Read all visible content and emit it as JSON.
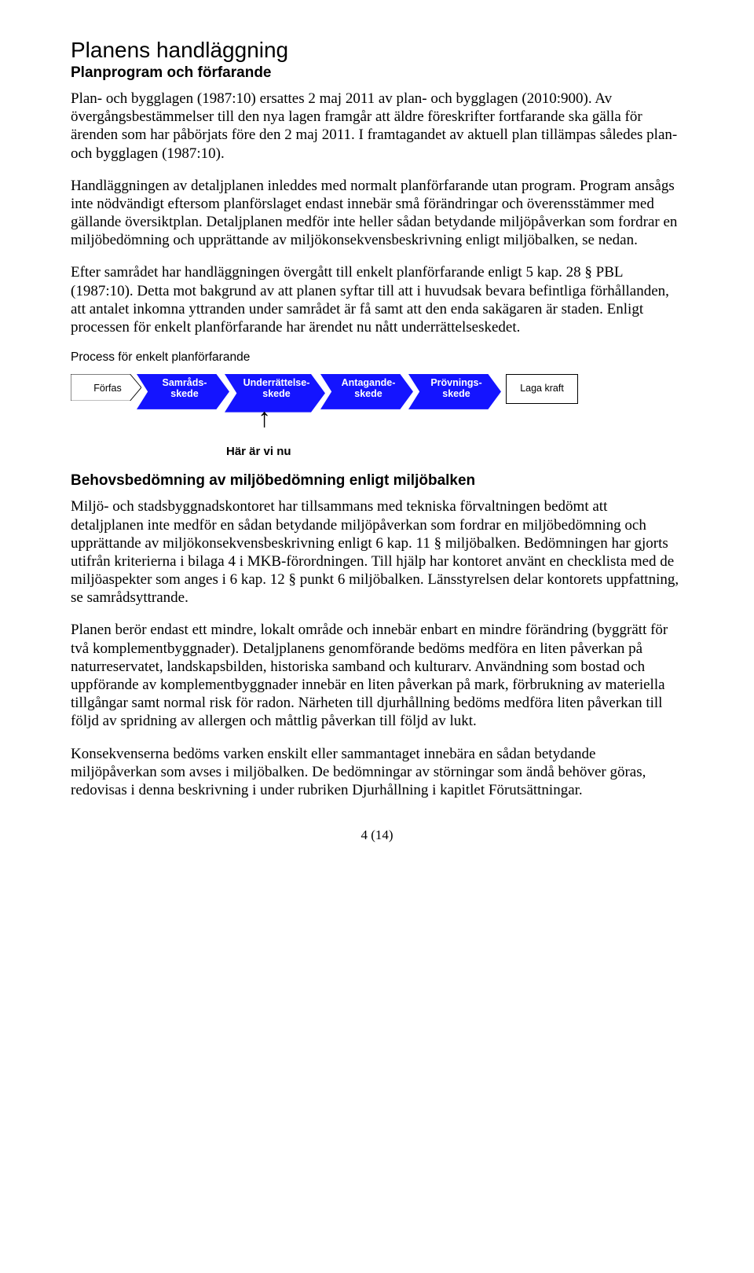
{
  "heading_main": "Planens handläggning",
  "heading_sub1": "Planprogram och förfarande",
  "para1": "Plan- och bygglagen (1987:10) ersattes 2 maj 2011 av plan- och bygglagen (2010:900). Av övergångsbestämmelser till den nya lagen framgår att äldre föreskrifter fortfarande ska gälla för ärenden som har påbörjats före den 2 maj 2011. I framtagandet av aktuell plan tillämpas således plan- och bygglagen (1987:10).",
  "para2": "Handläggningen av detaljplanen inleddes med normalt planförfarande utan program. Program ansågs inte nödvändigt eftersom planförslaget endast innebär små förändringar och överensstämmer med gällande översiktplan. Detaljplanen medför inte heller sådan betydande miljöpåverkan som fordrar en miljöbedömning och upprättande av miljökonsekvensbeskrivning enligt miljöbalken, se nedan.",
  "para3": "Efter samrådet har handläggningen övergått till enkelt planförfarande enligt 5 kap. 28 § PBL (1987:10). Detta mot bakgrund av att planen syftar till att i huvudsak bevara befintliga förhållanden, att antalet inkomna yttranden under samrådet är få samt att den enda sakägaren är staden. Enligt processen för enkelt planförfarande har ärendet nu nått underrättelseskedet.",
  "process_title": "Process för enkelt planförfarande",
  "phases": {
    "p0": "Förfas",
    "p1": "Samråds-\nskede",
    "p2": "Underrättelse-\nskede",
    "p3": "Antagande-\nskede",
    "p4": "Prövnings-\nskede",
    "p5": "Laga kraft"
  },
  "here_label": "Här är vi nu",
  "heading_sub2": "Behovsbedömning av miljöbedömning enligt miljöbalken",
  "para4": "Miljö- och stadsbyggnadskontoret har tillsammans med tekniska förvaltningen bedömt att detaljplanen inte medför en sådan betydande miljöpåverkan som fordrar en miljöbedömning och upprättande av miljökonsekvensbeskrivning enligt 6 kap. 11 § miljöbalken. Bedömningen har gjorts utifrån kriterierna i bilaga 4 i MKB-förordningen. Till hjälp har kontoret använt en checklista med de miljöaspekter som anges i 6 kap. 12 § punkt 6 miljöbalken. Länsstyrelsen delar kontorets uppfattning, se samrådsyttrande.",
  "para5": "Planen berör endast ett mindre, lokalt område och innebär enbart en mindre förändring (byggrätt för två komplementbyggnader). Detaljplanens genomförande bedöms medföra en liten påverkan på naturreservatet, landskapsbilden, historiska samband och kulturarv. Användning som bostad och uppförande av komplementbyggnader innebär en liten påverkan på mark, förbrukning av materiella tillgångar samt normal risk för radon. Närheten till djurhållning bedöms medföra liten påverkan till följd av spridning av allergen och måttlig påverkan till följd av lukt.",
  "para6": "Konsekvenserna bedöms varken enskilt eller sammantaget innebära en sådan betydande miljöpåverkan som avses i miljöbalken. De bedömningar av störningar som ändå behöver göras, redovisas i denna beskrivning i under rubriken Djurhållning i kapitlet Förutsättningar.",
  "footer": "4 (14)"
}
